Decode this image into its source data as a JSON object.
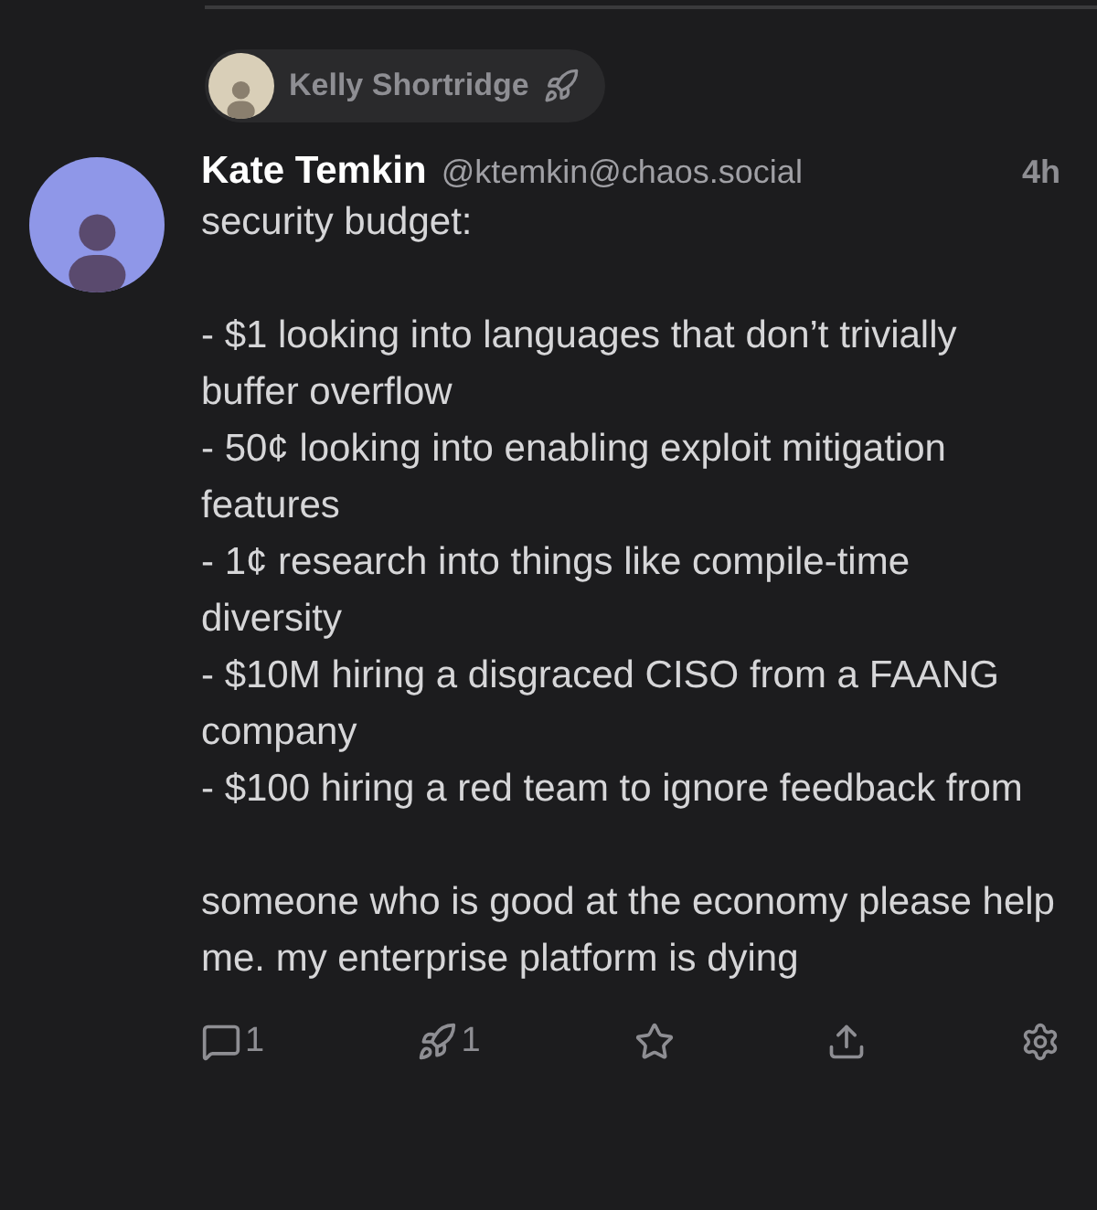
{
  "boosted_by": {
    "name": "Kelly Shortridge"
  },
  "post": {
    "display_name": "Kate Temkin",
    "handle": "@ktemkin@chaos.social",
    "time": "4h",
    "paragraphs": [
      [
        "security budget:"
      ],
      [
        "- $1 looking into languages that don’t trivially buffer overflow",
        "- 50¢ looking into enabling exploit mitigation features",
        "- 1¢ research into things like compile-time diversity",
        "- $10M hiring a disgraced CISO from a FAANG company",
        "- $100 hiring a red team to ignore feedback from"
      ],
      [
        "someone who is good at the economy please help me. my enterprise platform is dying"
      ]
    ]
  },
  "actions": [
    {
      "kind": "reply",
      "count": "1"
    },
    {
      "kind": "boost",
      "count": "1"
    },
    {
      "kind": "favourite"
    },
    {
      "kind": "share"
    },
    {
      "kind": "more"
    }
  ]
}
